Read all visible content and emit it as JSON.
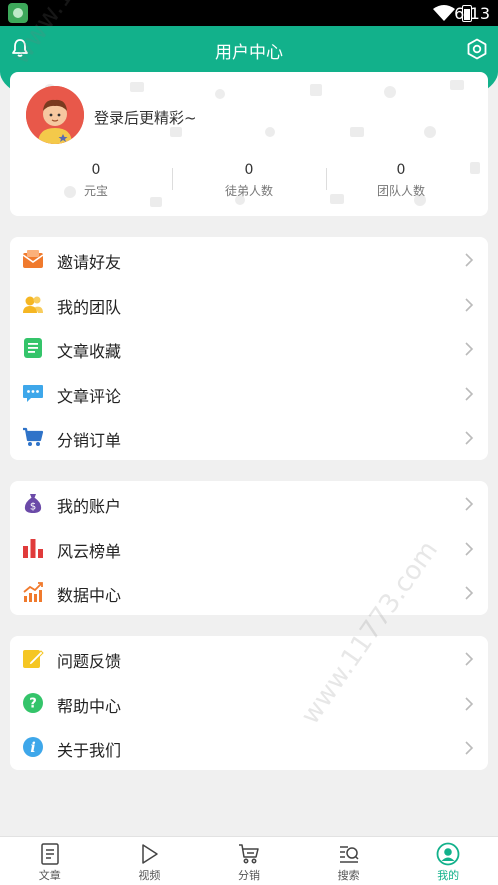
{
  "status_bar": {
    "time": "6:13"
  },
  "header": {
    "title": "用户中心"
  },
  "profile": {
    "login_prompt": "登录后更精彩~",
    "stats": [
      {
        "value": "0",
        "label": "元宝"
      },
      {
        "value": "0",
        "label": "徒弟人数"
      },
      {
        "value": "0",
        "label": "团队人数"
      }
    ]
  },
  "menu_group_1": [
    {
      "label": "邀请好友",
      "icon": "envelope-icon",
      "color": "#f07a2d"
    },
    {
      "label": "我的团队",
      "icon": "team-icon",
      "color": "#f5b623"
    },
    {
      "label": "文章收藏",
      "icon": "document-icon",
      "color": "#34c46a"
    },
    {
      "label": "文章评论",
      "icon": "comment-icon",
      "color": "#3ea7ea"
    },
    {
      "label": "分销订单",
      "icon": "cart-icon",
      "color": "#2f73c8"
    }
  ],
  "menu_group_2": [
    {
      "label": "我的账户",
      "icon": "money-bag-icon",
      "color": "#6b4aa8"
    },
    {
      "label": "风云榜单",
      "icon": "bar-chart-icon",
      "color": "#e03b3b"
    },
    {
      "label": "数据中心",
      "icon": "trend-chart-icon",
      "color": "#f07a2d"
    }
  ],
  "menu_group_3": [
    {
      "label": "问题反馈",
      "icon": "edit-icon",
      "color": "#f5c623"
    },
    {
      "label": "帮助中心",
      "icon": "help-icon",
      "color": "#34c46a"
    },
    {
      "label": "关于我们",
      "icon": "info-icon",
      "color": "#3ea7ea"
    }
  ],
  "tabbar": {
    "active_index": 4,
    "tabs": [
      {
        "label": "文章",
        "icon": "article-icon"
      },
      {
        "label": "视频",
        "icon": "play-icon"
      },
      {
        "label": "分销",
        "icon": "cart-icon"
      },
      {
        "label": "搜索",
        "icon": "search-icon"
      },
      {
        "label": "我的",
        "icon": "user-icon"
      }
    ]
  },
  "watermark": {
    "text": "www.11773.com"
  },
  "colors": {
    "brand": "#12b18b",
    "background": "#f0f0f0"
  }
}
